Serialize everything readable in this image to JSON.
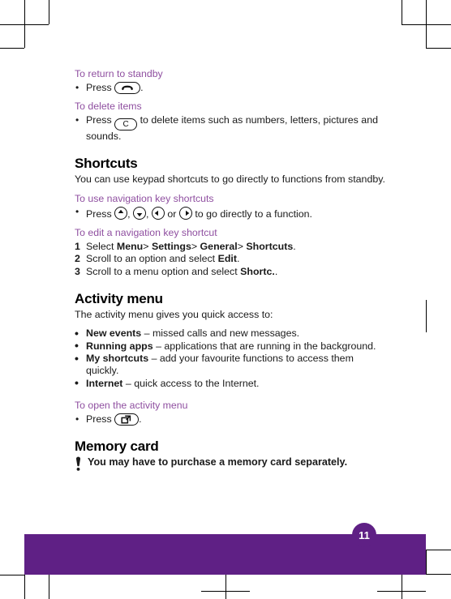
{
  "document": {
    "page_number": "11",
    "accent_purple": "#8f4fa0",
    "footer_purple": "#5f2085"
  },
  "sections": {
    "return_standby": {
      "heading": "To return to standby",
      "step_press": "Press",
      "step_end": ".",
      "key_icon": "end-call-key-icon"
    },
    "delete_items": {
      "heading": "To delete items",
      "step_press": "Press",
      "key_label": "C",
      "step_rest": "to delete items such as numbers, letters, pictures and sounds.",
      "key_icon": "clear-key-icon"
    },
    "shortcuts": {
      "heading": "Shortcuts",
      "intro": "You can use keypad shortcuts to go directly to functions from standby.",
      "nav_shortcuts": {
        "heading": "To use navigation key shortcuts",
        "press": "Press",
        "sep1": ",",
        "sep2": ",",
        "or": "or",
        "rest": "to go directly to a function.",
        "keys": [
          "nav-key-up-icon",
          "nav-key-down-icon",
          "nav-key-left-icon",
          "nav-key-right-icon"
        ]
      },
      "edit_shortcut": {
        "heading": "To edit a navigation key shortcut",
        "steps": [
          {
            "lead": "Select",
            "b1": "Menu",
            "gt1": ">",
            "b2": "Settings",
            "gt2": ">",
            "b3": "General",
            "gt3": ">",
            "b4": "Shortcuts",
            "tail": "."
          },
          {
            "lead": "Scroll to an option and select",
            "b1": "Edit",
            "tail": "."
          },
          {
            "lead": "Scroll to a menu option and select",
            "b1": "Shortc.",
            "tail": "."
          }
        ]
      }
    },
    "activity_menu": {
      "heading": "Activity menu",
      "intro": "The activity menu gives you quick access to:",
      "items": [
        {
          "term": "New events",
          "desc": "– missed calls and new messages."
        },
        {
          "term": "Running apps",
          "desc": "– applications that are running in the background."
        },
        {
          "term": "My shortcuts",
          "desc": "– add your favourite functions to access them quickly."
        },
        {
          "term": "Internet",
          "desc": "– quick access to the Internet."
        }
      ],
      "open_menu": {
        "heading": "To open the activity menu",
        "press": "Press",
        "tail": ".",
        "key_icon": "activity-menu-key-icon"
      }
    },
    "memory_card": {
      "heading": "Memory card",
      "note": "You may have to purchase a memory card separately.",
      "note_icon": "exclamation-note-icon"
    }
  }
}
